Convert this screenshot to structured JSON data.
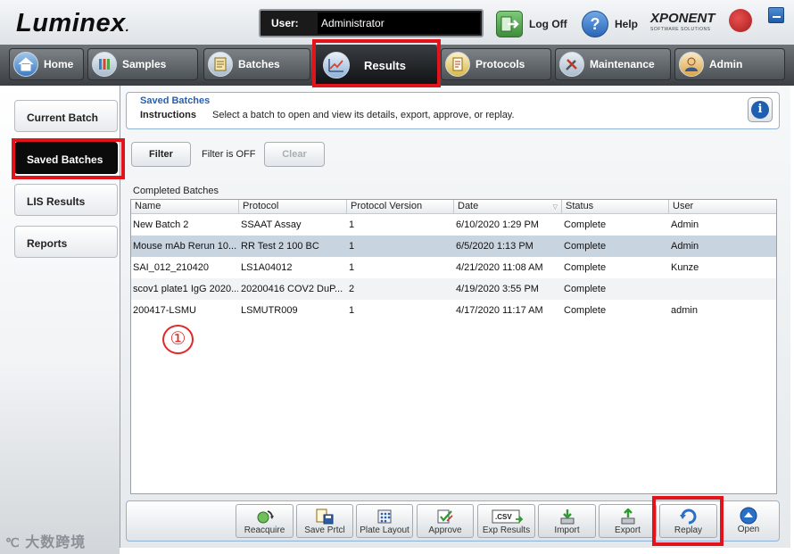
{
  "header": {
    "logo": "Luminex",
    "logo_mark": ".",
    "user_label": "User:",
    "user_value": "Administrator",
    "logoff_label": "Log Off",
    "help_label": "Help",
    "product_name": "XPONENT",
    "product_sub": "SOFTWARE SOLUTIONS"
  },
  "nav": {
    "tabs": [
      {
        "label": "Home",
        "icon": "home-icon"
      },
      {
        "label": "Samples",
        "icon": "samples-icon"
      },
      {
        "label": "Batches",
        "icon": "batches-icon"
      },
      {
        "label": "Results",
        "icon": "results-chart-icon",
        "active": true
      },
      {
        "label": "Protocols",
        "icon": "protocols-icon"
      },
      {
        "label": "Maintenance",
        "icon": "maintenance-tools-icon"
      },
      {
        "label": "Admin",
        "icon": "admin-user-icon"
      }
    ]
  },
  "sidebar": {
    "items": [
      {
        "label": "Current Batch"
      },
      {
        "label": "Saved Batches",
        "active": true
      },
      {
        "label": "LIS Results"
      },
      {
        "label": "Reports"
      }
    ],
    "watermark": "大数跨境"
  },
  "instructions": {
    "title": "Saved Batches",
    "label": "Instructions",
    "text": "Select a batch to open and view its details, export, approve, or replay."
  },
  "filter": {
    "filter_button": "Filter",
    "status": "Filter is OFF",
    "clear_button": "Clear"
  },
  "batches": {
    "section_label": "Completed Batches",
    "columns": [
      "Name",
      "Protocol",
      "Protocol Version",
      "Date",
      "Status",
      "User"
    ],
    "rows": [
      [
        "New Batch 2",
        "SSAAT Assay",
        "1",
        "6/10/2020 1:29 PM",
        "Complete",
        "Admin"
      ],
      [
        "Mouse mAb Rerun 10...",
        "RR Test 2 100 BC",
        "1",
        "6/5/2020 1:13 PM",
        "Complete",
        "Admin"
      ],
      [
        "SAI_012_210420",
        "LS1A04012",
        "1",
        "4/21/2020 11:08 AM",
        "Complete",
        "Kunze"
      ],
      [
        "scov1 plate1 IgG 2020...",
        "20200416 COV2 DuP...",
        "2",
        "4/19/2020 3:55 PM",
        "Complete",
        ""
      ],
      [
        "200417-LSMU",
        "LSMUTR009",
        "1",
        "4/17/2020 11:17 AM",
        "Complete",
        "admin"
      ]
    ],
    "selected_row": 1
  },
  "annotation": {
    "marker": "①"
  },
  "toolbar": {
    "buttons": [
      {
        "label": "Reacquire",
        "icon": "reacquire-icon"
      },
      {
        "label": "Save Prtcl",
        "icon": "save-protocol-icon"
      },
      {
        "label": "Plate Layout",
        "icon": "plate-layout-icon"
      },
      {
        "label": "Approve",
        "icon": "approve-icon"
      },
      {
        "label": "Exp Results",
        "icon": "export-results-csv-icon",
        "icon_text": ".CSV"
      },
      {
        "label": "Import",
        "icon": "import-icon"
      },
      {
        "label": "Export",
        "icon": "export-icon"
      },
      {
        "label": "Replay",
        "icon": "replay-icon"
      },
      {
        "label": "Open",
        "icon": "open-icon"
      }
    ]
  },
  "colors": {
    "highlight": "#e0141a",
    "accent_blue": "#2860b0",
    "selected_row": "#c9d4e1"
  }
}
